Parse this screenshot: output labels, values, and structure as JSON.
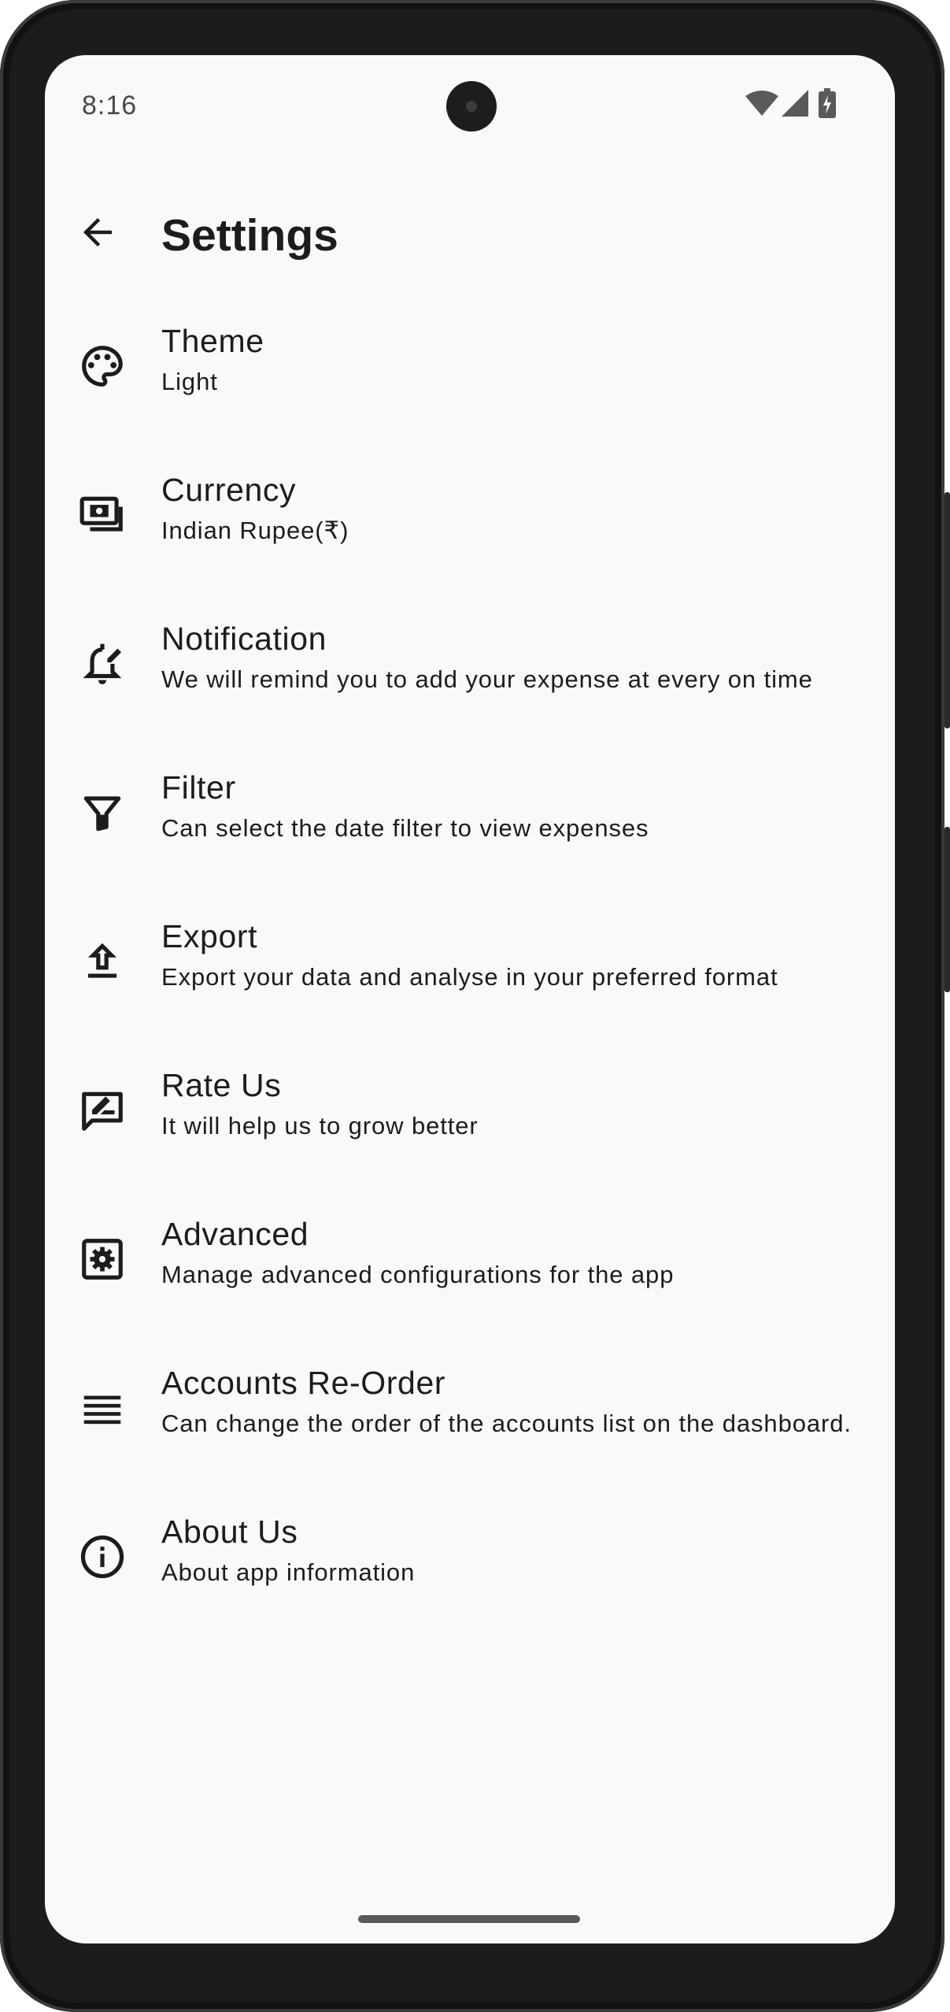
{
  "status_bar": {
    "time": "8:16"
  },
  "header": {
    "title": "Settings",
    "back_icon": "arrow-back-icon"
  },
  "settings": [
    {
      "icon": "palette-icon",
      "title": "Theme",
      "subtitle": "Light"
    },
    {
      "icon": "money-icon",
      "title": "Currency",
      "subtitle": "Indian Rupee(₹)"
    },
    {
      "icon": "notification-edit-icon",
      "title": "Notification",
      "subtitle": "We will remind you to add your expense at every on time"
    },
    {
      "icon": "filter-icon",
      "title": "Filter",
      "subtitle": "Can select the date filter to view expenses"
    },
    {
      "icon": "upload-icon",
      "title": "Export",
      "subtitle": "Export your data and analyse in your preferred format"
    },
    {
      "icon": "rate-review-icon",
      "title": "Rate Us",
      "subtitle": "It will help us to grow better"
    },
    {
      "icon": "settings-applications-icon",
      "title": "Advanced",
      "subtitle": "Manage advanced configurations for the app"
    },
    {
      "icon": "reorder-icon",
      "title": "Accounts Re-Order",
      "subtitle": "Can change the order of the accounts list on the dashboard."
    },
    {
      "icon": "info-icon",
      "title": "About Us",
      "subtitle": "About app information"
    }
  ],
  "colors": {
    "background": "#f8f9f8",
    "text": "#1c1c1c",
    "frame": "#1c1c1c"
  }
}
